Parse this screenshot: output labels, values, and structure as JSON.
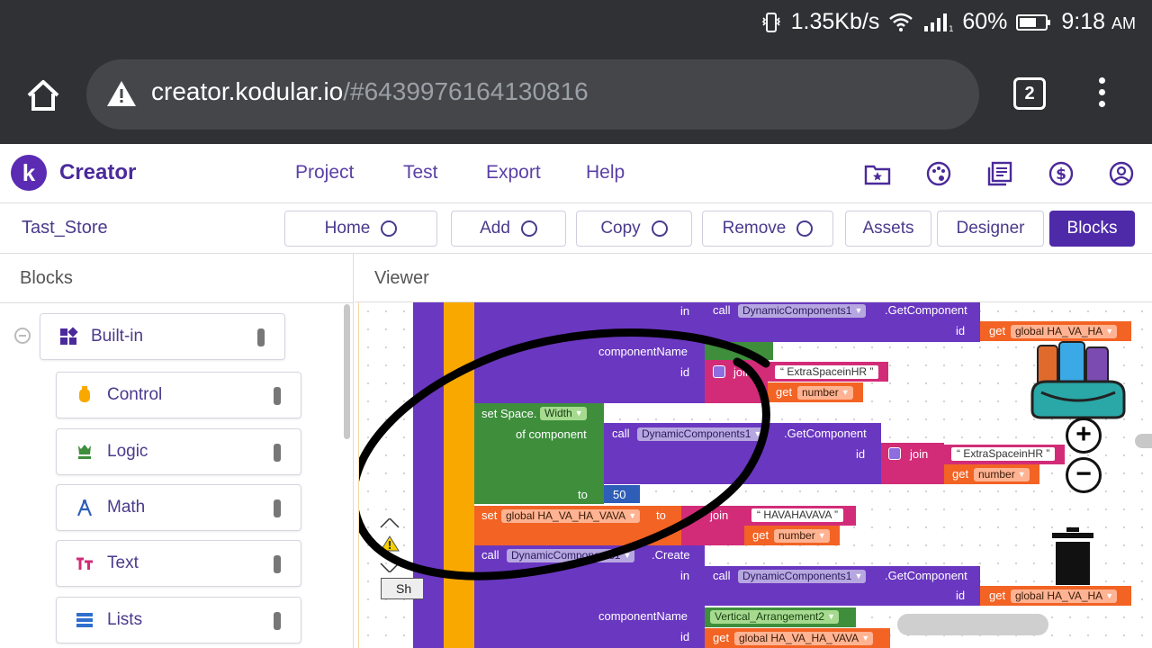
{
  "status": {
    "net_speed": "1.35Kb/s",
    "signal_sub": "H",
    "battery": "60%",
    "time": "9:18",
    "ampm": "AM"
  },
  "browser": {
    "url_host": "creator.kodular.io",
    "url_path": "/#6439976164130816",
    "tab_count": "2"
  },
  "app": {
    "brand": "Creator",
    "logo_letter": "k",
    "nav": [
      "Project",
      "Test",
      "Export",
      "Help"
    ],
    "icons": [
      "starred-folder-icon",
      "palette-icon",
      "library-icon",
      "dollar-icon",
      "account-icon"
    ]
  },
  "toolbar": {
    "project_name": "Tast_Store",
    "home_label": "Home",
    "add_label": "Add",
    "copy_label": "Copy",
    "remove_label": "Remove",
    "assets_label": "Assets",
    "designer_label": "Designer",
    "blocks_label": "Blocks"
  },
  "blocks_panel": {
    "title": "Blocks",
    "builtin": "Built-in",
    "items": [
      {
        "label": "Control",
        "icon": "control-icon",
        "color": "#f9a800"
      },
      {
        "label": "Logic",
        "icon": "logic-icon",
        "color": "#3e8e3c"
      },
      {
        "label": "Math",
        "icon": "math-icon",
        "color": "#2e5eb8"
      },
      {
        "label": "Text",
        "icon": "text-icon",
        "color": "#d22c78"
      },
      {
        "label": "Lists",
        "icon": "lists-icon",
        "color": "#2e6fcf"
      }
    ]
  },
  "viewer": {
    "title": "Viewer",
    "blocks": {
      "in1": "in",
      "call1": "call",
      "dc1": "DynamicComponents1",
      "getcomp1": ".GetComponent",
      "id1": "id",
      "get1": "get",
      "var1": "global HA_VA_HA",
      "compname1": "componentName",
      "id2": "id",
      "join1": "join",
      "str1": "“ ExtraSpaceinHR ”",
      "get2": "get",
      "num1": "number",
      "setspace": "set Space.",
      "width": "Width",
      "ofcomp": "of component",
      "call2": "call",
      "dc2": "DynamicComponents1",
      "getcomp2": ".GetComponent",
      "id3": "id",
      "join2": "join",
      "str2": "“ ExtraSpaceinHR ”",
      "get3": "get",
      "num2": "number",
      "to1": "to",
      "fifty": "50",
      "set2": "set",
      "var2": "global HA_VA_HA_VAVA",
      "to2": "to",
      "join3": "join",
      "str3": "“ HAVAHAVAVA ”",
      "get4": "get",
      "num3": "number",
      "call3": "call",
      "dc3": "DynamicComponents1",
      "create": ".Create",
      "in2": "in",
      "call4": "call",
      "dc4": "DynamicComponents1",
      "getcomp3": ".GetComponent",
      "id4": "id",
      "get5": "get",
      "var3": "global HA_VA_HA",
      "compname2": "componentName",
      "arr": "Vertical_Arrangement2",
      "id5": "id",
      "get6": "get",
      "var4": "global HA_VA_HA_VAVA",
      "sh": "Sh"
    }
  }
}
